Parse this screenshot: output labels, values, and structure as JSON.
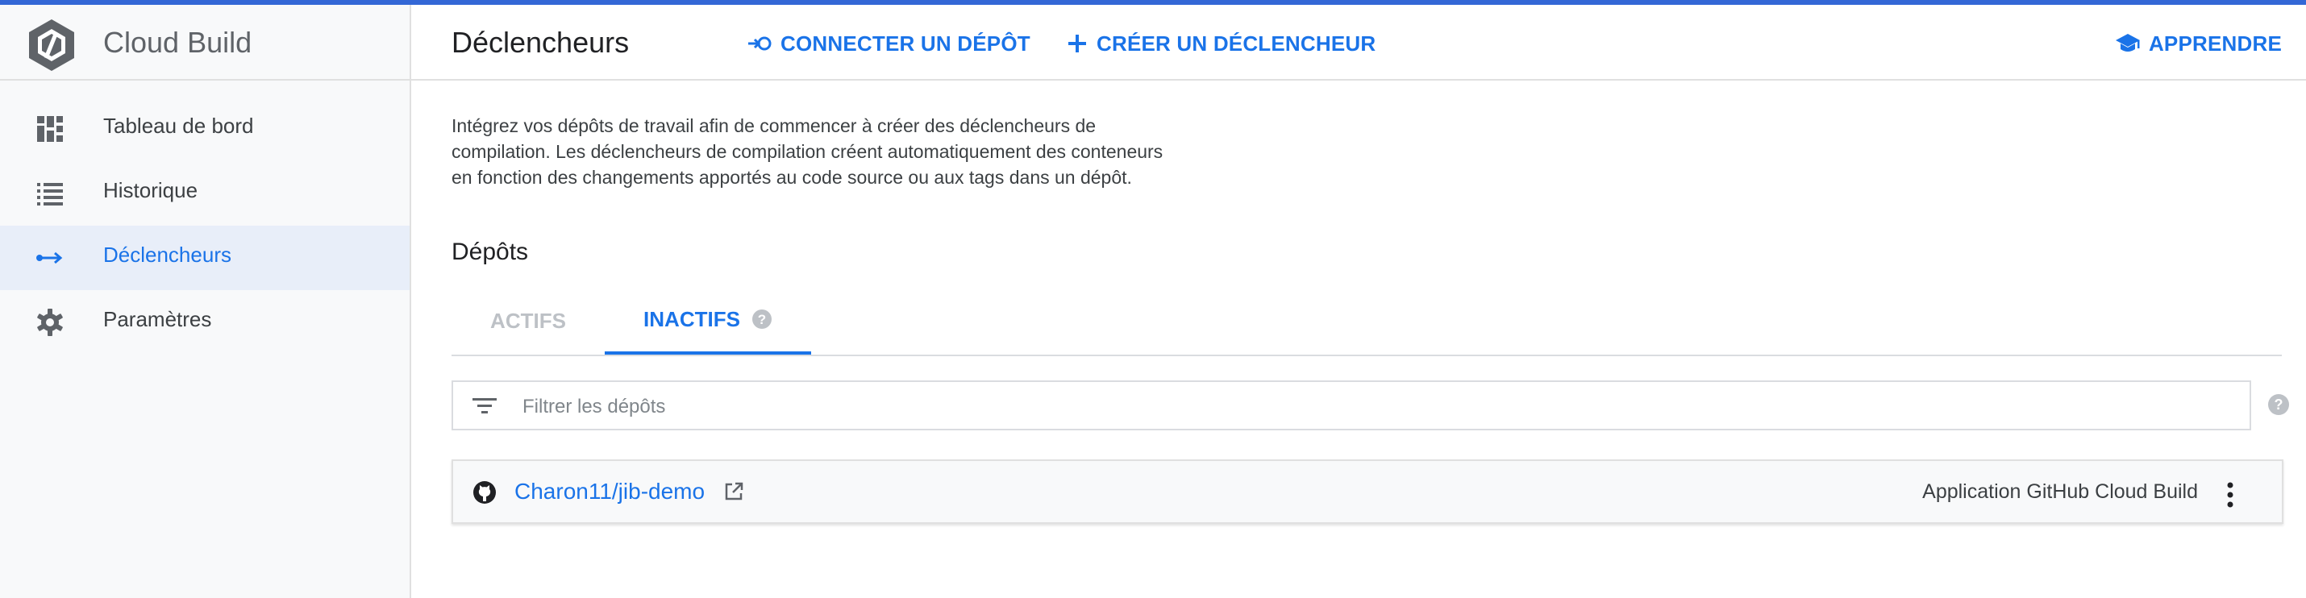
{
  "app": {
    "name": "Cloud Build"
  },
  "sidebar": {
    "items": [
      {
        "label": "Tableau de bord",
        "icon": "dashboard-icon"
      },
      {
        "label": "Historique",
        "icon": "list-icon"
      },
      {
        "label": "Déclencheurs",
        "icon": "trigger-arrow-icon",
        "active": true
      },
      {
        "label": "Paramètres",
        "icon": "gear-icon"
      }
    ]
  },
  "header": {
    "title": "Déclencheurs",
    "connect_label": "CONNECTER UN DÉPÔT",
    "create_label": "CRÉER UN DÉCLENCHEUR",
    "learn_label": "APPRENDRE"
  },
  "main": {
    "intro": "Intégrez vos dépôts de travail afin de commencer à créer des déclencheurs de compilation. Les déclencheurs de compilation créent automatiquement des conteneurs en fonction des changements apportés au code source ou aux tags dans un dépôt.",
    "section_title": "Dépôts",
    "tabs": [
      {
        "label": "ACTIFS",
        "selected": false
      },
      {
        "label": "INACTIFS",
        "selected": true
      }
    ],
    "filter": {
      "placeholder": "Filtrer les dépôts",
      "value": ""
    },
    "repos": [
      {
        "name": "Charon11/jib-demo",
        "app": "Application GitHub Cloud Build"
      }
    ]
  },
  "colors": {
    "accent": "#1a73e8",
    "topbar": "#3367d6",
    "sidebar_bg": "#f8f9fa",
    "active_bg": "#e8eef9"
  }
}
